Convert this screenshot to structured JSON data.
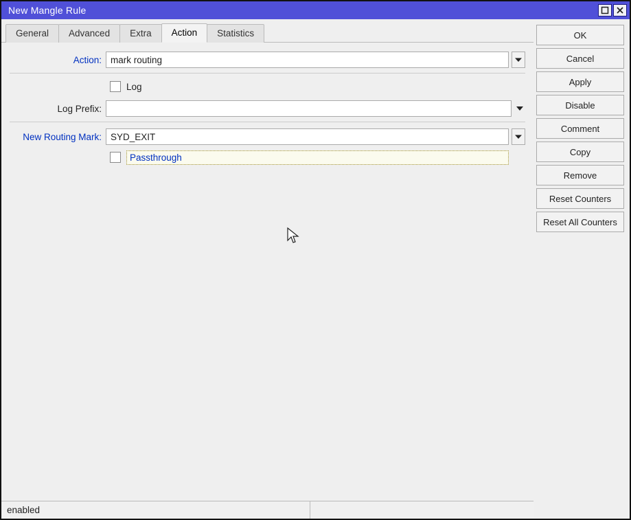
{
  "window": {
    "title": "New Mangle Rule"
  },
  "tabs": {
    "general": "General",
    "advanced": "Advanced",
    "extra": "Extra",
    "action": "Action",
    "statistics": "Statistics",
    "active": "action"
  },
  "form": {
    "action_label": "Action:",
    "action_value": "mark routing",
    "log_label": "Log",
    "log_checked": false,
    "log_prefix_label": "Log Prefix:",
    "log_prefix_value": "",
    "new_routing_mark_label": "New Routing Mark:",
    "new_routing_mark_value": "SYD_EXIT",
    "passthrough_label": "Passthrough",
    "passthrough_checked": false
  },
  "buttons": {
    "ok": "OK",
    "cancel": "Cancel",
    "apply": "Apply",
    "disable": "Disable",
    "comment": "Comment",
    "copy": "Copy",
    "remove": "Remove",
    "reset_counters": "Reset Counters",
    "reset_all_counters": "Reset All Counters"
  },
  "status": {
    "left": "enabled",
    "right": ""
  }
}
